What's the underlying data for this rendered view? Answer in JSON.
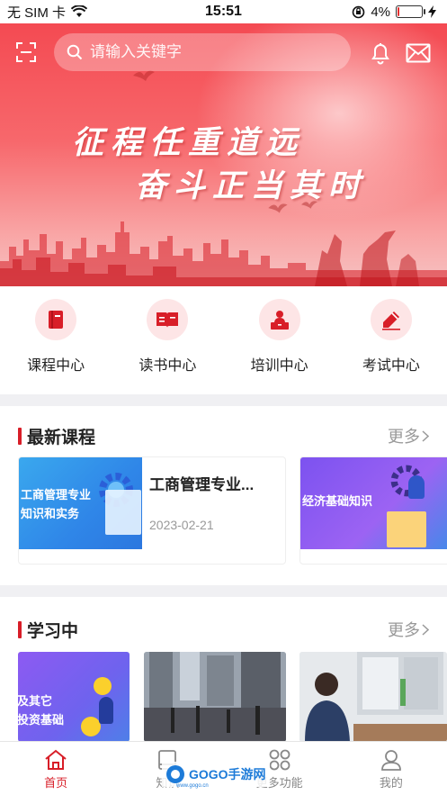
{
  "status_bar": {
    "carrier": "无 SIM 卡",
    "time": "15:51",
    "battery_percent": "4%",
    "battery_level": 0.04
  },
  "header": {
    "search_placeholder": "请输入关键字"
  },
  "banner": {
    "slogan_line1": "征程任重道远",
    "slogan_line2": "奋斗正当其时"
  },
  "quick_nav": [
    {
      "label": "课程中心",
      "icon": "book-icon"
    },
    {
      "label": "读书中心",
      "icon": "open-book-icon"
    },
    {
      "label": "培训中心",
      "icon": "lecturer-icon"
    },
    {
      "label": "考试中心",
      "icon": "pencil-icon"
    }
  ],
  "latest_courses": {
    "title": "最新课程",
    "more_label": "更多",
    "items": [
      {
        "thumb_text": "工商管理专业\n知识和实务",
        "title": "工商管理专业...",
        "date": "2023-02-21"
      },
      {
        "thumb_text": "经济基础知识"
      }
    ]
  },
  "learning": {
    "title": "学习中",
    "more_label": "更多",
    "items": [
      {
        "thumb_text": "及其它\n投资基础"
      },
      {
        "thumb_text": ""
      },
      {
        "thumb_text": ""
      }
    ]
  },
  "tab_bar": [
    {
      "label": "首页",
      "icon": "home-icon",
      "active": true
    },
    {
      "label": "知识",
      "icon": "book-tab-icon",
      "active": false
    },
    {
      "label": "更多功能",
      "icon": "grid-icon",
      "active": false
    },
    {
      "label": "我的",
      "icon": "user-icon",
      "active": false
    }
  ],
  "watermark": {
    "text": "GOGO手游网",
    "url": "www.gogo.cn"
  },
  "colors": {
    "accent": "#d81e28",
    "banner_red": "#f44a52",
    "icon_bg": "#fde5e6"
  }
}
